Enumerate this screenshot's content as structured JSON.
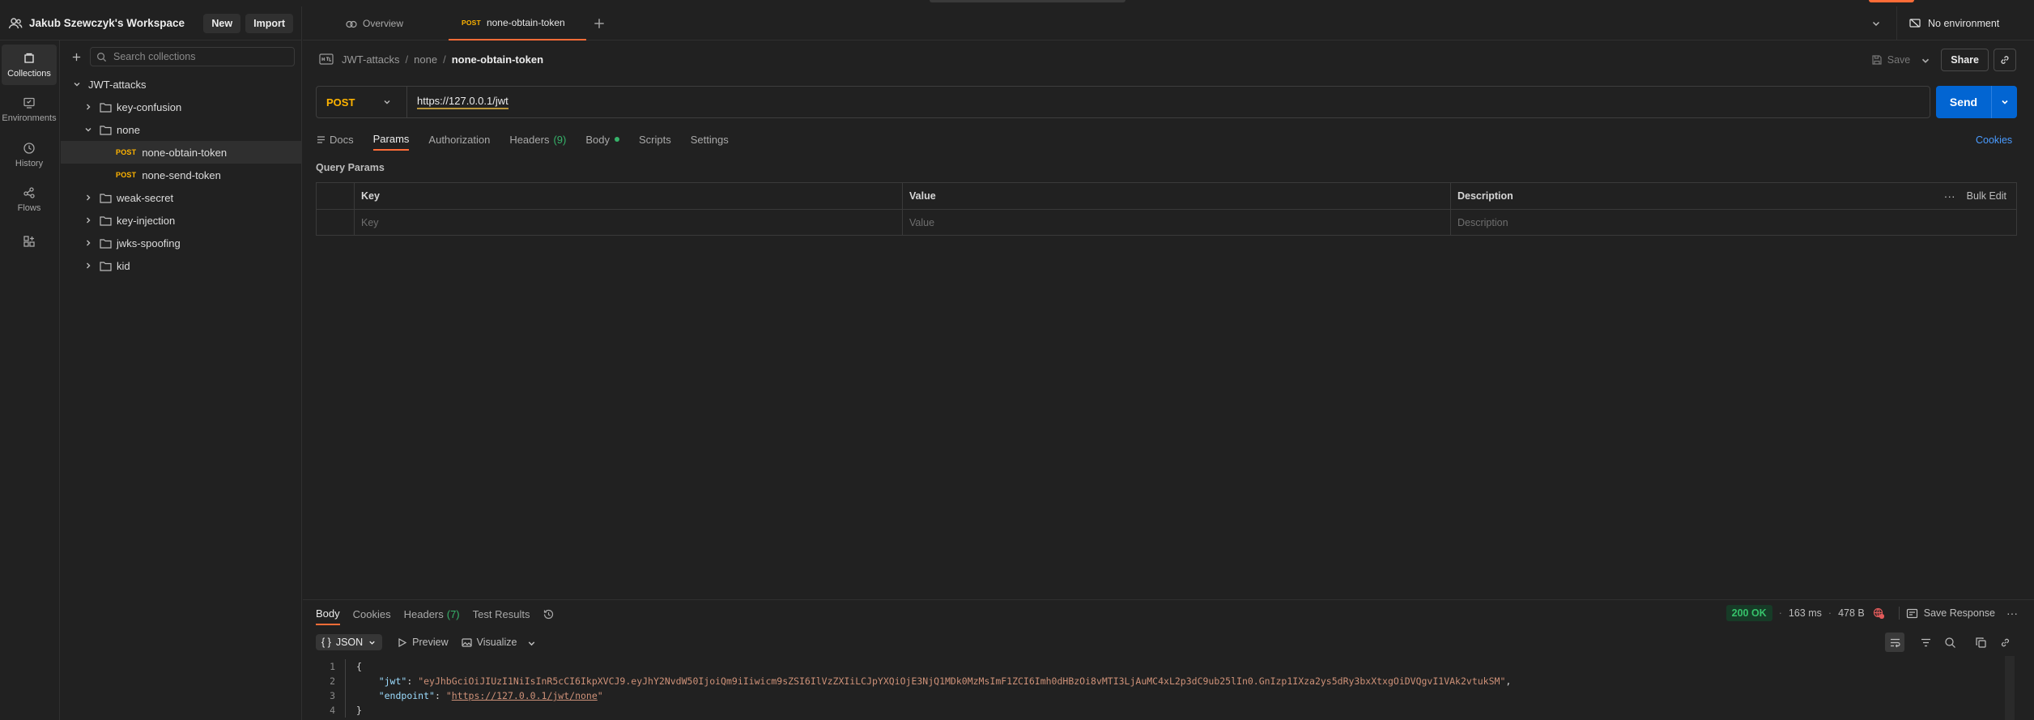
{
  "workspace": {
    "title": "Jakub Szewczyk's Workspace",
    "new_label": "New",
    "import_label": "Import"
  },
  "rail": {
    "items": [
      {
        "label": "Collections",
        "icon": "collections-icon"
      },
      {
        "label": "Environments",
        "icon": "environments-icon"
      },
      {
        "label": "History",
        "icon": "history-icon"
      },
      {
        "label": "Flows",
        "icon": "flows-icon"
      },
      {
        "label": "",
        "icon": "apps-icon"
      }
    ]
  },
  "collections": {
    "search_placeholder": "Search collections",
    "root": "JWT-attacks",
    "items": [
      {
        "type": "folder",
        "label": "key-confusion",
        "expanded": false
      },
      {
        "type": "folder",
        "label": "none",
        "expanded": true
      },
      {
        "type": "request",
        "method": "POST",
        "label": "none-obtain-token",
        "selected": true
      },
      {
        "type": "request",
        "method": "POST",
        "label": "none-send-token"
      },
      {
        "type": "folder",
        "label": "weak-secret",
        "expanded": false
      },
      {
        "type": "folder",
        "label": "key-injection",
        "expanded": false
      },
      {
        "type": "folder",
        "label": "jwks-spoofing",
        "expanded": false
      },
      {
        "type": "folder",
        "label": "kid",
        "expanded": false
      }
    ]
  },
  "tabs": {
    "overview_label": "Overview",
    "active": {
      "method": "POST",
      "label": "none-obtain-token"
    },
    "environment": "No environment"
  },
  "breadcrumb": {
    "items": [
      "JWT-attacks",
      "none"
    ],
    "current": "none-obtain-token",
    "save_label": "Save",
    "share_label": "Share"
  },
  "request": {
    "method": "POST",
    "url": "https://127.0.0.1/jwt",
    "send_label": "Send",
    "tabs": {
      "docs": "Docs",
      "params": "Params",
      "authorization": "Authorization",
      "headers": "Headers",
      "headers_count": "(9)",
      "body": "Body",
      "scripts": "Scripts",
      "settings": "Settings"
    },
    "cookies_label": "Cookies",
    "query_params_title": "Query Params",
    "columns": {
      "key": "Key",
      "value": "Value",
      "description": "Description",
      "bulk_edit": "Bulk Edit"
    },
    "placeholders": {
      "key": "Key",
      "value": "Value",
      "description": "Description"
    }
  },
  "response": {
    "tabs": {
      "body": "Body",
      "cookies": "Cookies",
      "headers": "Headers",
      "headers_count": "(7)",
      "test_results": "Test Results"
    },
    "status": "200 OK",
    "time": "163 ms",
    "size": "478 B",
    "save_response_label": "Save Response",
    "format": "JSON",
    "preview_label": "Preview",
    "visualize_label": "Visualize",
    "lines": [
      "1",
      "2",
      "3",
      "4"
    ],
    "open_brace": "{",
    "close_brace": "}",
    "jwt_key": "\"jwt\"",
    "jwt_value": "\"eyJhbGciOiJIUzI1NiIsInR5cCI6IkpXVCJ9.eyJhY2NvdW50IjoiQm9iIiwicm9sZSI6IlVzZXIiLCJpYXQiOjE3NjQ1MDk0MzMsImF1ZCI6Imh0dHBzOi8vMTI3LjAuMC4xL2p3dC9ub25lIn0.GnIzp1IXza2ys5dRy3bxXtxgOiDVQgvI1VAk2vtukSM\"",
    "endpoint_key": "\"endpoint\"",
    "endpoint_value": "\"https://127.0.0.1/jwt/none\"",
    "endpoint_url": "https://127.0.0.1/jwt/none"
  }
}
